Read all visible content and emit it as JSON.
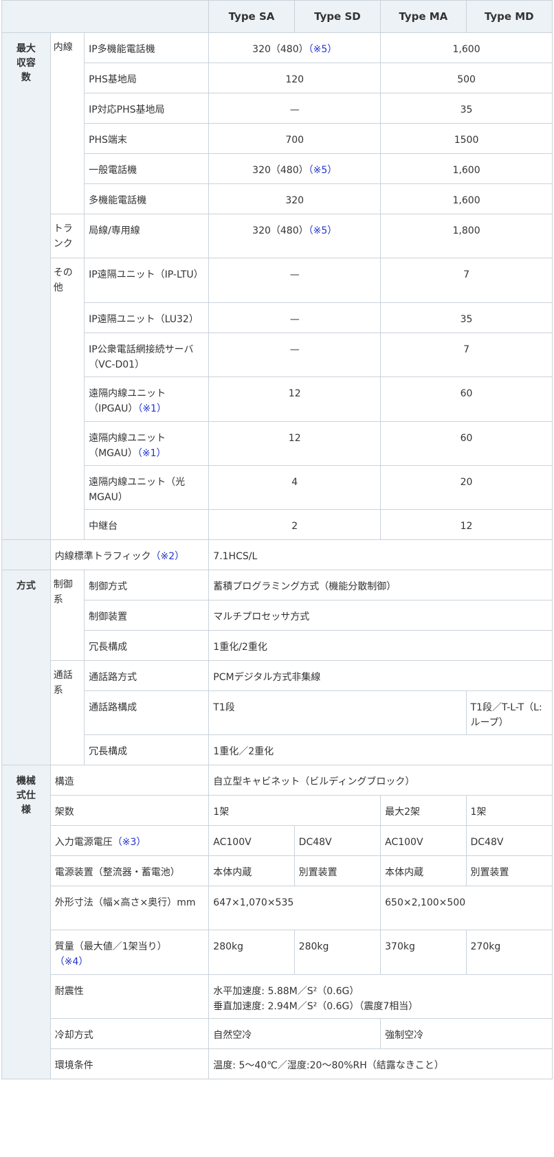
{
  "header": {
    "types": [
      "Type SA",
      "Type SD",
      "Type MA",
      "Type MD"
    ]
  },
  "categories": {
    "capacity": [
      "最大",
      "収容",
      "数"
    ],
    "method": [
      "方式"
    ],
    "mech": [
      "機械",
      "式仕",
      "様"
    ]
  },
  "subcats": {
    "naisen": [
      "内線"
    ],
    "trunk": [
      "トラ",
      "ンク"
    ],
    "other": [
      "その",
      "他"
    ],
    "control": [
      "制御",
      "系"
    ],
    "call": [
      "通話",
      "系"
    ]
  },
  "capacity_rows": [
    {
      "item": "IP多機能電話機",
      "s": "320（480）",
      "s_note": "（※5）",
      "m": "1,600"
    },
    {
      "item": "PHS基地局",
      "s": "120",
      "m": "500"
    },
    {
      "item": "IP対応PHS基地局",
      "s": "—",
      "m": "35"
    },
    {
      "item": "PHS端末",
      "s": "700",
      "m": "1500"
    },
    {
      "item": "一般電話機",
      "s": "320（480）",
      "s_note": "（※5）",
      "m": "1,600"
    },
    {
      "item": "多機能電話機",
      "s": "320",
      "m": "1,600"
    },
    {
      "item": "局線/専用線",
      "s": "320（480）",
      "s_note": "（※5）",
      "m": "1,800"
    },
    {
      "item": "IP遠隔ユニット（IP-LTU）",
      "s": "—",
      "m": "7"
    },
    {
      "item": "IP遠隔ユニット（LU32）",
      "s": "—",
      "m": "35"
    },
    {
      "item": "IP公衆電話網接続サーバ（VC-D01）",
      "s": "—",
      "m": "7"
    },
    {
      "item": "遠隔内線ユニット（IPGAU）",
      "item_note": "（※1）",
      "s": "12",
      "m": "60"
    },
    {
      "item": "遠隔内線ユニット（MGAU）",
      "item_note": "（※1）",
      "s": "12",
      "m": "60"
    },
    {
      "item": "遠隔内線ユニット（光MGAU）",
      "s": "4",
      "m": "20"
    },
    {
      "item": "中継台",
      "s": "2",
      "m": "12"
    }
  ],
  "traffic": {
    "label": "内線標準トラフィック",
    "note": "（※2）",
    "value": "7.1HCS/L"
  },
  "method_rows": {
    "control_method": {
      "item": "制御方式",
      "value": "蓄積プログラミング方式（機能分散制御）"
    },
    "control_device": {
      "item": "制御装置",
      "value": "マルチプロセッサ方式"
    },
    "control_redundancy": {
      "item": "冗長構成",
      "value": "1重化/2重化"
    },
    "path_method": {
      "item": "通話路方式",
      "value": "PCMデジタル方式非集線"
    },
    "path_config": {
      "item": "通話路構成",
      "value_a": "T1段",
      "value_b": "T1段／T-L-T（L: ループ）"
    },
    "call_redundancy": {
      "item": "冗長構成",
      "value": "1重化／2重化"
    }
  },
  "mech_rows": {
    "structure": {
      "item": "構造",
      "value": "自立型キャビネット（ビルディングブロック）"
    },
    "racks": {
      "item": "架数",
      "sa_sd": "1架",
      "ma": "最大2架",
      "md": "1架"
    },
    "voltage": {
      "item": "入力電源電圧",
      "note": "（※3）",
      "sa": "AC100V",
      "sd": "DC48V",
      "ma": "AC100V",
      "md": "DC48V"
    },
    "power": {
      "item": "電源装置（整流器・蓄電池）",
      "sa": "本体内蔵",
      "sd": "別置装置",
      "ma": "本体内蔵",
      "md": "別置装置"
    },
    "dimensions": {
      "item": "外形寸法（幅×高さ×奥行）mm",
      "s": "647×1,070×535",
      "m": "650×2,100×500"
    },
    "mass": {
      "item": "質量（最大値／1架当り）",
      "note": "（※4）",
      "sa": "280kg",
      "sd": "280kg",
      "ma": "370kg",
      "md": "270kg"
    },
    "seismic": {
      "item": "耐震性",
      "line1": "水平加速度: 5.88M／S²（0.6G）",
      "line2": "垂直加速度: 2.94M／S²（0.6G）（震度7相当）"
    },
    "cooling": {
      "item": "冷却方式",
      "s": "自然空冷",
      "m": "強制空冷"
    },
    "environment": {
      "item": "環境条件",
      "value": "温度: 5〜40℃／湿度:20〜80%RH（結露なきこと）"
    }
  }
}
